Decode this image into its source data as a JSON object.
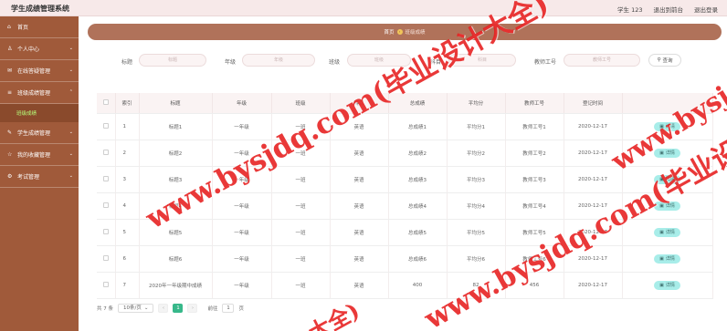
{
  "app": {
    "title": "学生成绩管理系统"
  },
  "topbar": {
    "user": "学生 123",
    "back_front": "退出到前台",
    "logout": "退出登录"
  },
  "sidebar": {
    "items": [
      {
        "label": "首页",
        "icon": "home-icon",
        "glyph": "⌂",
        "has_arrow": false
      },
      {
        "label": "个人中心",
        "icon": "person-icon",
        "glyph": "♙",
        "has_arrow": true
      },
      {
        "label": "在线答疑管理",
        "icon": "chat-icon",
        "glyph": "✉",
        "has_arrow": true
      },
      {
        "label": "班级成绩管理",
        "icon": "grade-icon",
        "glyph": "≡",
        "has_arrow": true,
        "expanded": true
      },
      {
        "label": "学生成绩管理",
        "icon": "score-icon",
        "glyph": "✎",
        "has_arrow": true
      },
      {
        "label": "我的收藏管理",
        "icon": "star-icon",
        "glyph": "☆",
        "has_arrow": true
      },
      {
        "label": "考试管理",
        "icon": "exam-icon",
        "glyph": "⚙",
        "has_arrow": true
      }
    ],
    "submenu_active": "班级成绩"
  },
  "breadcrumb": {
    "home": "首页",
    "current": "班级成绩"
  },
  "search": {
    "fields": [
      {
        "label": "标题",
        "placeholder": "标题"
      },
      {
        "label": "年级",
        "placeholder": "年级"
      },
      {
        "label": "班级",
        "placeholder": "班级"
      },
      {
        "label": "科目",
        "placeholder": "科目"
      },
      {
        "label": "教师工号",
        "placeholder": "教师工号"
      }
    ],
    "button": "查询"
  },
  "table": {
    "headers": [
      "",
      "索引",
      "标题",
      "年级",
      "班级",
      "科目",
      "总成绩",
      "平均分",
      "教师工号",
      "登记时间",
      ""
    ],
    "rows": [
      [
        "1",
        "标题1",
        "一年级",
        "一班",
        "英语",
        "总成绩1",
        "平均分1",
        "教师工号1",
        "2020-12-17"
      ],
      [
        "2",
        "标题2",
        "一年级",
        "一班",
        "英语",
        "总成绩2",
        "平均分2",
        "教师工号2",
        "2020-12-17"
      ],
      [
        "3",
        "标题3",
        "一年级",
        "一班",
        "英语",
        "总成绩3",
        "平均分3",
        "教师工号3",
        "2020-12-17"
      ],
      [
        "4",
        "标题4",
        "一年级",
        "一班",
        "英语",
        "总成绩4",
        "平均分4",
        "教师工号4",
        "2020-12-17"
      ],
      [
        "5",
        "标题5",
        "一年级",
        "一班",
        "英语",
        "总成绩5",
        "平均分5",
        "教师工号5",
        "2020-12-17"
      ],
      [
        "6",
        "标题6",
        "一年级",
        "一班",
        "英语",
        "总成绩6",
        "平均分6",
        "教师工号6",
        "2020-12-17"
      ],
      [
        "7",
        "2020年一年级期中成绩",
        "一年级",
        "一班",
        "英语",
        "400",
        "82",
        "456",
        "2020-12-17"
      ]
    ],
    "detail_label": "详情"
  },
  "pagination": {
    "total": "共 7 条",
    "page_size": "10条/页",
    "current_page": "1",
    "goto_prefix": "前往",
    "goto_value": "1",
    "goto_suffix": "页"
  },
  "watermark": {
    "text": "www.bysjdq.com(毕业设计大全)",
    "text_bottom": "大全)",
    "color": "#e61c1c"
  },
  "colors": {
    "sidebar": "#a05a3a",
    "breadcrumb": "#b0725a",
    "detail_button": "#a8ede9",
    "pager_active": "#37b88a"
  }
}
